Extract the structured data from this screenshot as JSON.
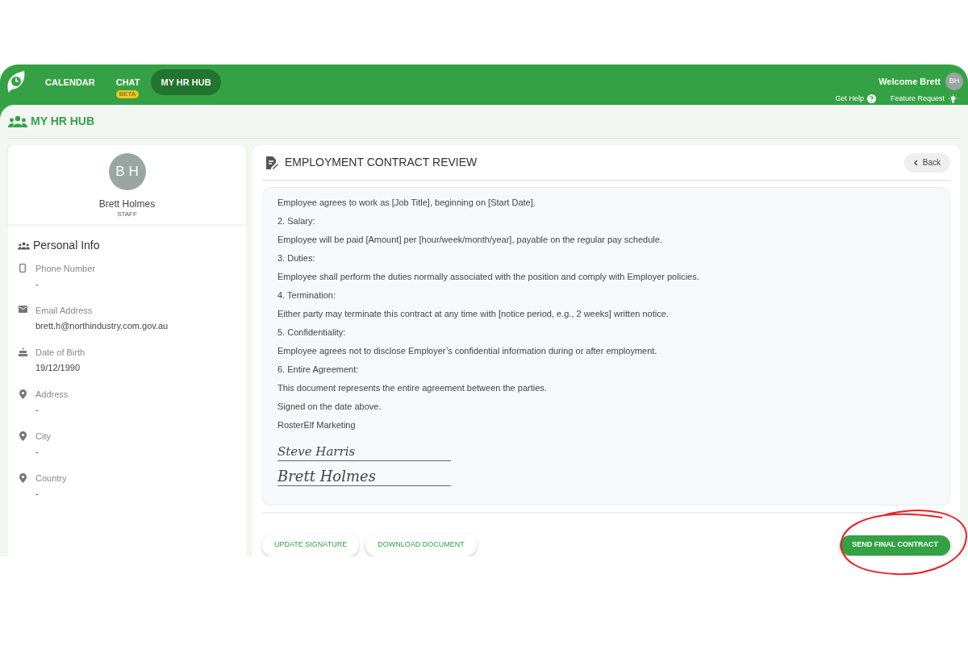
{
  "nav": {
    "items": [
      {
        "label": "CALENDAR",
        "selected": false
      },
      {
        "label": "CHAT",
        "selected": false,
        "badge": "BETA"
      },
      {
        "label": "MY HR HUB",
        "selected": true
      }
    ]
  },
  "header": {
    "welcome": "Welcome Brett",
    "avatar_initials": "BH",
    "links": [
      {
        "kind": "help",
        "label": "Get Help"
      },
      {
        "kind": "idea",
        "label": "Feature Request"
      }
    ]
  },
  "page_title": "MY HR HUB",
  "profile": {
    "initials": "B H",
    "name": "Brett Holmes",
    "role": "STAFF",
    "section_title": "Personal Info",
    "fields": [
      {
        "kind": "phone",
        "label": "Phone Number",
        "value": "-"
      },
      {
        "kind": "email",
        "label": "Email Address",
        "value": "brett.h@northindustry.com.gov.au"
      },
      {
        "kind": "birthday",
        "label": "Date of Birth",
        "value": "19/12/1990"
      },
      {
        "kind": "location",
        "label": "Address",
        "value": "-"
      },
      {
        "kind": "location",
        "label": "City",
        "value": "-"
      },
      {
        "kind": "location",
        "label": "Country",
        "value": "-"
      }
    ]
  },
  "contract": {
    "title": "EMPLOYMENT CONTRACT REVIEW",
    "back_button": "Back",
    "lines": [
      "Employee agrees to work as [Job Title], beginning on [Start Date].",
      "2. Salary:",
      "Employee will be paid [Amount] per [hour/week/month/year], payable on the regular pay schedule.",
      "3. Duties:",
      "Employee shall perform the duties normally associated with the position and comply with Employer policies.",
      "4. Termination:",
      "Either party may terminate this contract at any time with [notice period, e.g., 2 weeks] written notice.",
      "5. Confidentiality:",
      "Employee agrees not to disclose Employer’s confidential information during or after employment.",
      "6. Entire Agreement:",
      "This document represents the entire agreement between the parties.",
      "Signed on the date above.",
      "RosterElf Marketing"
    ],
    "signatures": [
      "Steve Harris",
      "Brett Holmes"
    ],
    "buttons": [
      "UPDATE SIGNATURE",
      "DOWNLOAD DOCUMENT"
    ],
    "primary_button": "SEND FINAL CONTRACT"
  }
}
